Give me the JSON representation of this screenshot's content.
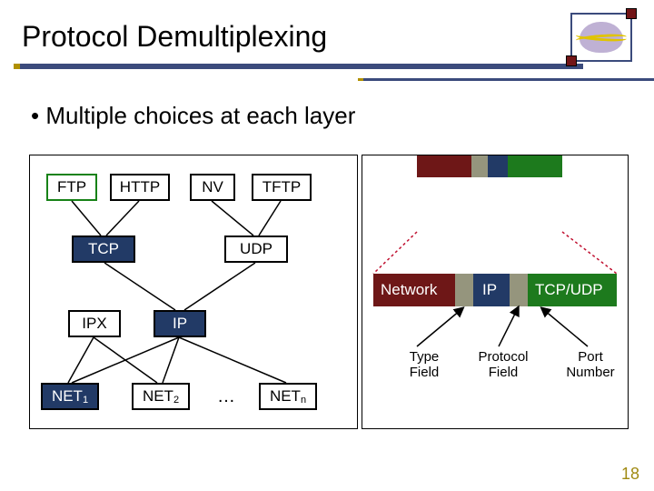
{
  "title": "Protocol Demultiplexing",
  "bullet": "Multiple choices at each layer",
  "left": {
    "apps": {
      "ftp": "FTP",
      "http": "HTTP",
      "nv": "NV",
      "tftp": "TFTP"
    },
    "transport": {
      "tcp": "TCP",
      "udp": "UDP"
    },
    "network": {
      "ipx": "IPX",
      "ip": "IP"
    },
    "link": {
      "n1_pre": "NET",
      "n1_sub": "1",
      "n2_pre": "NET",
      "n2_sub": "2",
      "dots": "…",
      "nn_pre": "NET",
      "nn_sub": "n"
    }
  },
  "right": {
    "header_bar": {
      "network": "Network",
      "ip": "IP",
      "tcpudp": "TCP/UDP"
    },
    "labels": {
      "type": "Type\nField",
      "proto": "Protocol\nField",
      "port": "Port\nNumber"
    }
  },
  "page": "18"
}
